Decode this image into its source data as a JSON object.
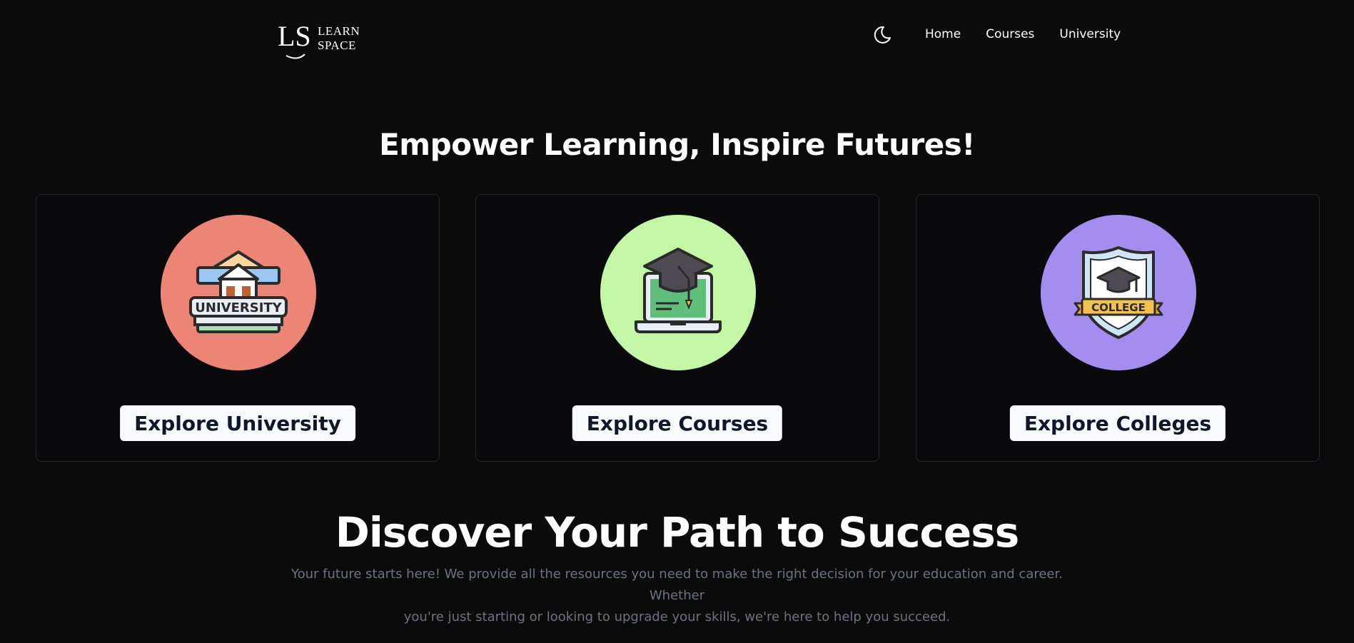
{
  "logo": {
    "mark": "LS",
    "line1": "LEARN",
    "line2": "SPACE"
  },
  "header": {
    "theme_icon": "moon-icon",
    "nav": [
      "Home",
      "Courses",
      "University"
    ]
  },
  "hero": {
    "title": "Empower Learning, Inspire Futures!"
  },
  "cards": [
    {
      "button_label": "Explore University",
      "icon": "university-building-icon",
      "badge_text": "UNIVERSITY",
      "circle_color": "#ec8576"
    },
    {
      "button_label": "Explore Courses",
      "icon": "laptop-graduation-cap-icon",
      "circle_color": "#c3f7a5"
    },
    {
      "button_label": "Explore Colleges",
      "icon": "college-shield-icon",
      "badge_text": "COLLEGE",
      "circle_color": "#a38ef0"
    }
  ],
  "discover": {
    "title": "Discover Your Path to Success",
    "text_line1": "Your future starts here! We provide all the resources you need to make the right decision for your education and career. Whether",
    "text_line2": "you're just starting or looking to upgrade your skills, we're here to help you succeed."
  }
}
